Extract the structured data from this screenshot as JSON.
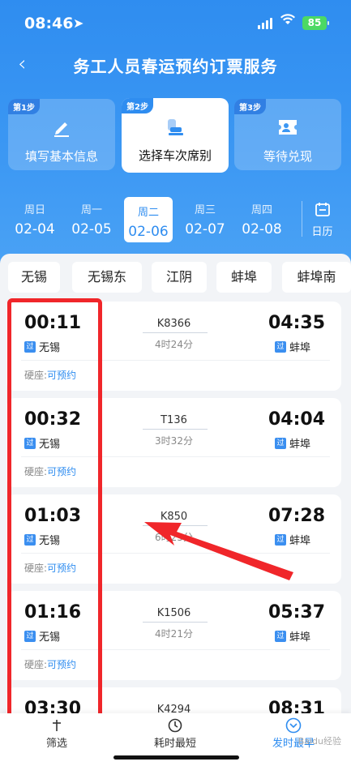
{
  "status": {
    "time": "08:46",
    "battery": "85"
  },
  "nav": {
    "back": "‹",
    "title": "务工人员春运预约订票服务"
  },
  "steps": [
    {
      "tag": "第1步",
      "label": "填写基本信息"
    },
    {
      "tag": "第2步",
      "label": "选择车次席别"
    },
    {
      "tag": "第3步",
      "label": "等待兑现"
    }
  ],
  "dates": [
    {
      "weekday": "周日",
      "date": "02-04"
    },
    {
      "weekday": "周一",
      "date": "02-05"
    },
    {
      "weekday": "周二",
      "date": "02-06"
    },
    {
      "weekday": "周三",
      "date": "02-07"
    },
    {
      "weekday": "周四",
      "date": "02-08"
    }
  ],
  "calendar_label": "日历",
  "stations": [
    "无锡",
    "无锡东",
    "江阴",
    "蚌埠",
    "蚌埠南"
  ],
  "pass_badge": "过",
  "trains": [
    {
      "dep": "00:11",
      "from": "无锡",
      "no": "K8366",
      "dur": "4时24分",
      "arr": "04:35",
      "to": "蚌埠",
      "seat": "硬座:",
      "status": "可预约"
    },
    {
      "dep": "00:32",
      "from": "无锡",
      "no": "T136",
      "dur": "3时32分",
      "arr": "04:04",
      "to": "蚌埠",
      "seat": "硬座:",
      "status": "可预约"
    },
    {
      "dep": "01:03",
      "from": "无锡",
      "no": "K850",
      "dur": "6时25分",
      "arr": "07:28",
      "to": "蚌埠",
      "seat": "硬座:",
      "status": "可预约"
    },
    {
      "dep": "01:16",
      "from": "无锡",
      "no": "K1506",
      "dur": "4时21分",
      "arr": "05:37",
      "to": "蚌埠",
      "seat": "硬座:",
      "status": "可预约"
    },
    {
      "dep": "03:30",
      "from": "",
      "no": "K4294",
      "dur": "",
      "arr": "08:31",
      "to": "",
      "seat": "",
      "status": ""
    }
  ],
  "bottom": [
    {
      "label": "筛选",
      "icon": "filter-icon"
    },
    {
      "label": "耗时最短",
      "icon": "clock-icon"
    },
    {
      "label": "发时最早",
      "icon": "earliest-icon"
    }
  ],
  "watermark": "Baidu经验"
}
